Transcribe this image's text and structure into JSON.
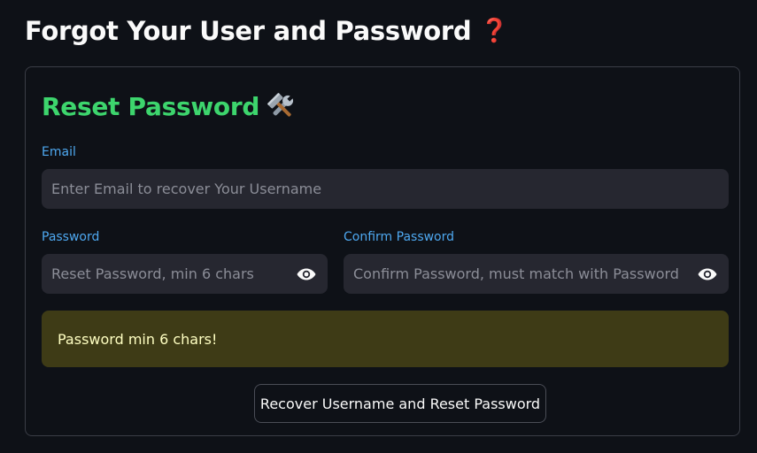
{
  "page": {
    "title": "Forgot Your User and Password",
    "title_icon": "question-mark-icon"
  },
  "form": {
    "title": "Reset Password",
    "title_icon": "hammer-and-wrench-icon",
    "email": {
      "label": "Email",
      "value": "",
      "placeholder": "Enter Email to recover Your Username"
    },
    "password": {
      "label": "Password",
      "value": "",
      "placeholder": "Reset Password, min 6 chars",
      "toggle_icon": "eye-icon"
    },
    "confirm_password": {
      "label": "Confirm Password",
      "value": "",
      "placeholder": "Confirm Password, must match with Password",
      "toggle_icon": "eye-icon"
    },
    "warning": {
      "text": "Password min 6 chars!"
    },
    "submit_label": "Recover Username and Reset Password"
  },
  "colors": {
    "background": "#0e1117",
    "heading_green": "#3dd56d",
    "label_blue": "#4ea8f0",
    "input_bg": "#262730",
    "warning_bg": "#3e3b16",
    "warning_text": "#ffffc2",
    "question_red": "#e0202a"
  }
}
